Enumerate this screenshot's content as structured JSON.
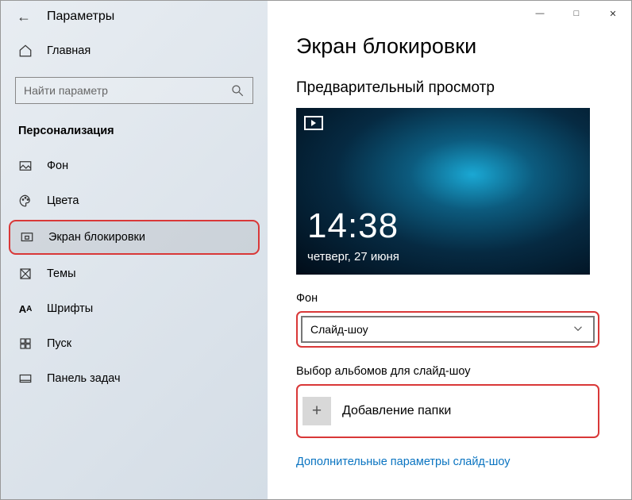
{
  "window": {
    "title": "Параметры"
  },
  "sidebar": {
    "home_label": "Главная",
    "search_placeholder": "Найти параметр",
    "section_header": "Персонализация",
    "items": [
      {
        "label": "Фон"
      },
      {
        "label": "Цвета"
      },
      {
        "label": "Экран блокировки"
      },
      {
        "label": "Темы"
      },
      {
        "label": "Шрифты"
      },
      {
        "label": "Пуск"
      },
      {
        "label": "Панель задач"
      }
    ]
  },
  "main": {
    "heading": "Экран блокировки",
    "preview_label": "Предварительный просмотр",
    "preview_time": "14:38",
    "preview_date": "четверг, 27 июня",
    "background_label": "Фон",
    "background_value": "Слайд-шоу",
    "albums_label": "Выбор альбомов для слайд-шоу",
    "add_folder_label": "Добавление папки",
    "advanced_link": "Дополнительные параметры слайд-шоу"
  }
}
